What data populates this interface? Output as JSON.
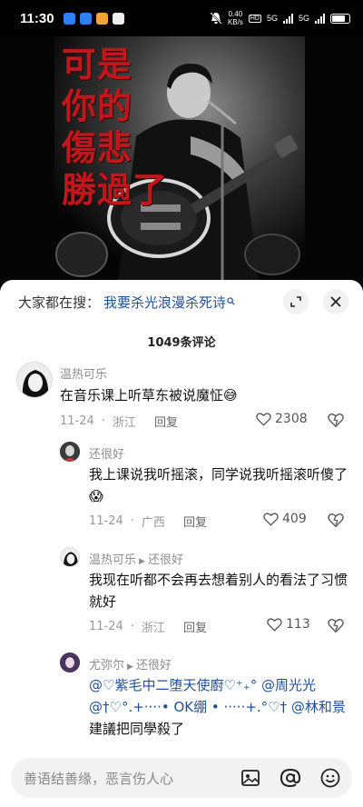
{
  "status_bar": {
    "time": "11:30",
    "net_speed_value": "0.40",
    "net_speed_unit": "KB/s",
    "hd": "HD",
    "signal1": "5G",
    "signal2": "5G"
  },
  "poster": {
    "text": "可是\n你的\n傷悲\n勝過了"
  },
  "search": {
    "prefix": "大家都在搜：",
    "query": "我要杀光浪漫杀死诗"
  },
  "comments_header": {
    "count_label": "1049条评论"
  },
  "comments": [
    {
      "user": "温热可乐",
      "text": "在音乐课上听草东被说魔怔😅",
      "date": "11-24",
      "location": "浙江",
      "reply": "回复",
      "likes": "2308"
    },
    {
      "user": "还很好",
      "text": "我上课说我听摇滚，同学说我听摇滚听傻了😱",
      "date": "11-24",
      "location": "广西",
      "reply": "回复",
      "likes": "409"
    },
    {
      "user": "温热可乐",
      "reply_to": "还很好",
      "text": "我现在听都不会再去想着别人的看法了习惯就好",
      "date": "11-24",
      "location": "浙江",
      "reply": "回复",
      "likes": "113"
    },
    {
      "user": "尤弥尔",
      "reply_to": "还很好",
      "text_mentions": "@♡紫毛中二堕天使廚♡⁺₊°   @周光光 @†♡°.+····• OK绷 • ·····+.°♡† @林和景",
      "text_tail": " 建議把同學殺了"
    }
  ],
  "input_bar": {
    "placeholder": "善语结善缘，恶言伤人心"
  }
}
